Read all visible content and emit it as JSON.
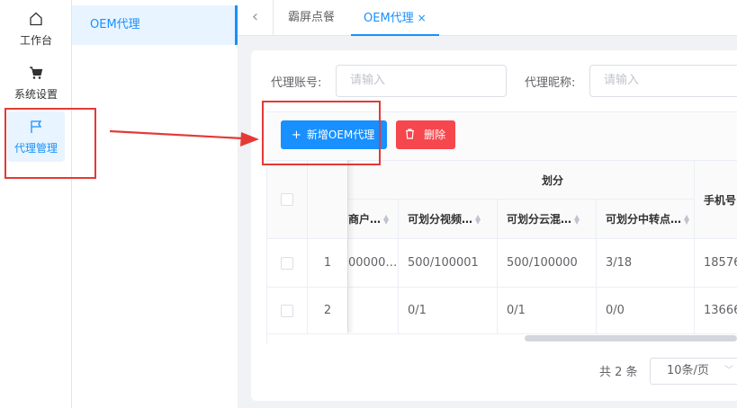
{
  "sidebar": {
    "items": [
      {
        "label": "工作台",
        "icon": "home-icon"
      },
      {
        "label": "系统设置",
        "icon": "cart-icon"
      },
      {
        "label": "代理管理",
        "icon": "flag-icon"
      }
    ],
    "submenu": {
      "label": "OEM代理"
    }
  },
  "tabs": {
    "back_icon": "chevron-left-icon",
    "items": [
      {
        "label": "霸屏点餐"
      },
      {
        "label": "OEM代理",
        "close": "×"
      }
    ]
  },
  "filters": {
    "account": {
      "label": "代理账号:",
      "placeholder": "请输入"
    },
    "nickname": {
      "label": "代理昵称:",
      "placeholder": "请输入"
    }
  },
  "toolbar": {
    "add_label": "新增OEM代理",
    "add_icon": "+",
    "delete_label": "删除",
    "delete_icon": "trash-icon"
  },
  "table": {
    "group_header": "划分",
    "columns": [
      "商户…",
      "可划分视频…",
      "可划分云混…",
      "可划分中转点…"
    ],
    "phone_header": "手机号",
    "rows": [
      {
        "index": "1",
        "c0": "00000…",
        "c1": "500/100001",
        "c2": "500/100000",
        "c3": "3/18",
        "phone": "18576"
      },
      {
        "index": "2",
        "c0": "",
        "c1": "0/1",
        "c2": "0/1",
        "c3": "0/0",
        "phone": "13666"
      }
    ]
  },
  "pagination": {
    "total": "共 2 条",
    "page_size": "10条/页"
  },
  "colors": {
    "primary": "#1890ff",
    "danger": "#f5474d",
    "annotation": "#e53935"
  }
}
